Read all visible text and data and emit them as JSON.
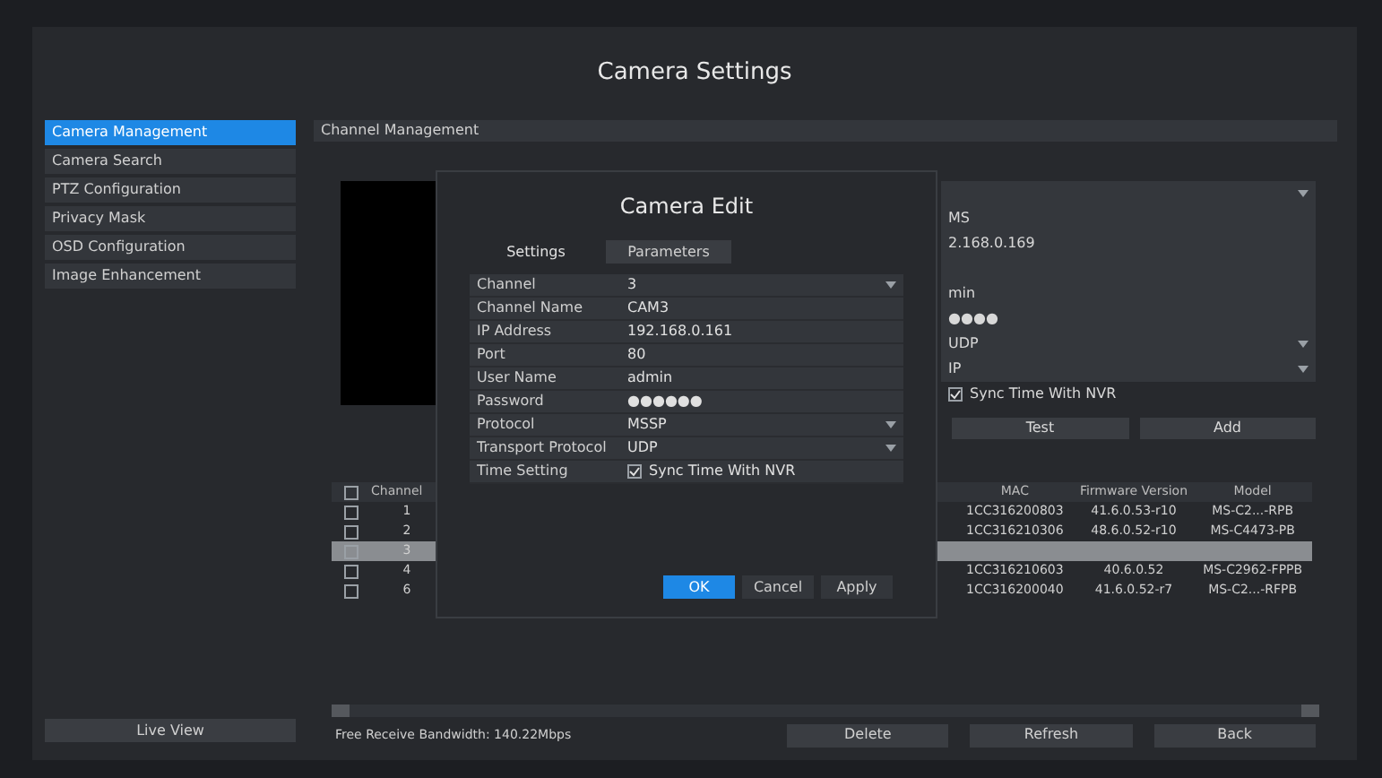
{
  "window": {
    "title": "Camera Settings"
  },
  "sidebar": {
    "items": [
      {
        "label": "Camera Management",
        "selected": true
      },
      {
        "label": "Camera Search",
        "selected": false
      },
      {
        "label": "PTZ Configuration",
        "selected": false
      },
      {
        "label": "Privacy Mask",
        "selected": false
      },
      {
        "label": "OSD Configuration",
        "selected": false
      },
      {
        "label": "Image Enhancement",
        "selected": false
      }
    ],
    "live_view_button": "Live View"
  },
  "section_title": "Channel Management",
  "background_form": {
    "rows": [
      {
        "kind": "select"
      },
      {
        "kind": "text",
        "value": "MS"
      },
      {
        "kind": "text",
        "value": "2.168.0.169"
      },
      {
        "kind": "text"
      },
      {
        "kind": "text",
        "value": "min"
      },
      {
        "kind": "text",
        "value": "●●●●"
      },
      {
        "kind": "select",
        "value": "UDP"
      },
      {
        "kind": "select",
        "value": "IP"
      },
      {
        "kind": "check",
        "checked": true,
        "value": "Sync Time With NVR"
      }
    ],
    "buttons": [
      "Test",
      "Add"
    ]
  },
  "table": {
    "select_all_checked": false,
    "columns": [
      "Channel",
      "MAC",
      "Firmware Version",
      "Model"
    ],
    "rows": [
      {
        "checked": false,
        "selected": false,
        "channel": "1",
        "mac": "1CC316200803",
        "firmware": "41.6.0.53-r10",
        "model": "MS-C2...-RPB"
      },
      {
        "checked": false,
        "selected": false,
        "channel": "2",
        "mac": "1CC316210306",
        "firmware": "48.6.0.52-r10",
        "model": "MS-C4473-PB"
      },
      {
        "checked": false,
        "selected": true,
        "channel": "3"
      },
      {
        "checked": false,
        "selected": false,
        "channel": "4",
        "mac": "1CC316210603",
        "firmware": "40.6.0.52",
        "model": "MS-C2962-FPPB"
      },
      {
        "checked": false,
        "selected": false,
        "channel": "6",
        "mac": "1CC316200040",
        "firmware": "41.6.0.52-r7",
        "model": "MS-C2...-RFPB"
      }
    ]
  },
  "status_bar": {
    "bandwidth": "Free Receive Bandwidth: 140.22Mbps",
    "buttons": [
      "Delete",
      "Refresh",
      "Back"
    ]
  },
  "dialog": {
    "title": "Camera Edit",
    "tabs": [
      {
        "label": "Settings",
        "selected": true
      },
      {
        "label": "Parameters",
        "selected": false
      }
    ],
    "fields": [
      {
        "label": "Channel",
        "kind": "select",
        "value": "3"
      },
      {
        "label": "Channel Name",
        "kind": "text",
        "value": "CAM3"
      },
      {
        "label": "IP Address",
        "kind": "text",
        "value": "192.168.0.161"
      },
      {
        "label": "Port",
        "kind": "text",
        "value": "80"
      },
      {
        "label": "User Name",
        "kind": "text",
        "value": "admin"
      },
      {
        "label": "Password",
        "kind": "text",
        "value": "●●●●●●"
      },
      {
        "label": "Protocol",
        "kind": "select",
        "value": "MSSP"
      },
      {
        "label": "Transport Protocol",
        "kind": "select",
        "value": "UDP"
      },
      {
        "label": "Time Setting",
        "kind": "check",
        "checked": true,
        "value": "Sync Time With NVR"
      }
    ],
    "buttons": [
      {
        "label": "OK",
        "primary": true
      },
      {
        "label": "Cancel",
        "primary": false
      },
      {
        "label": "Apply",
        "primary": false
      }
    ]
  }
}
